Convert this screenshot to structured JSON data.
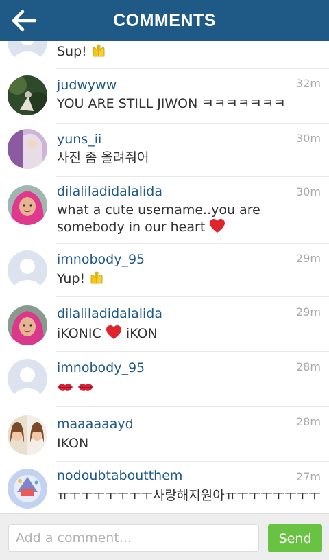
{
  "header": {
    "title": "COMMENTS",
    "back_icon": "back-arrow-icon"
  },
  "comments": [
    {
      "username": "",
      "time": "",
      "text": "Sup!",
      "emoji": "raised-hands-icon",
      "avatar": "default-avatar"
    },
    {
      "username": "judwyww",
      "time": "32m",
      "text": "YOU ARE STILL JIWON ㅋㅋㅋㅋㅋㅋㅋ",
      "emoji": "",
      "avatar": "photo-avatar"
    },
    {
      "username": "yuns_ii",
      "time": "30m",
      "text": "사진 좀 올려줘어",
      "emoji": "",
      "avatar": "photo-avatar"
    },
    {
      "username": "dilaliladidalalida",
      "time": "30m",
      "text": "what a cute username..you are",
      "text2": "somebody in our heart",
      "emoji": "red-heart-icon",
      "avatar": "photo-avatar"
    },
    {
      "username": "imnobody_95",
      "time": "29m",
      "text": "Yup!",
      "emoji": "raised-hands-icon",
      "avatar": "default-avatar"
    },
    {
      "username": "dilaliladidalalida",
      "time": "29m",
      "text_a": "iKONIC",
      "text_b": "iKON",
      "emoji": "red-heart-icon",
      "avatar": "photo-avatar"
    },
    {
      "username": "imnobody_95",
      "time": "28m",
      "emoji": "kiss-mark-icon",
      "avatar": "default-avatar"
    },
    {
      "username": "maaaaaayd",
      "time": "28m",
      "text": "IKON",
      "avatar": "photo-avatar"
    },
    {
      "username": "nodoubtaboutthem",
      "time": "27m",
      "text": "ㅠㅜㅜㅜㅜㅜㅜㅜ사랑해지원아ㅠㅜㅜㅜㅜㅜㅜㅜㅜ",
      "avatar": "illustration-avatar"
    }
  ],
  "composer": {
    "placeholder": "Add a comment...",
    "send_label": "Send"
  },
  "colors": {
    "header_bg": "#1f5a86",
    "username": "#1f5a86",
    "send_bg": "#6ac243",
    "heart": "#e0242c"
  }
}
